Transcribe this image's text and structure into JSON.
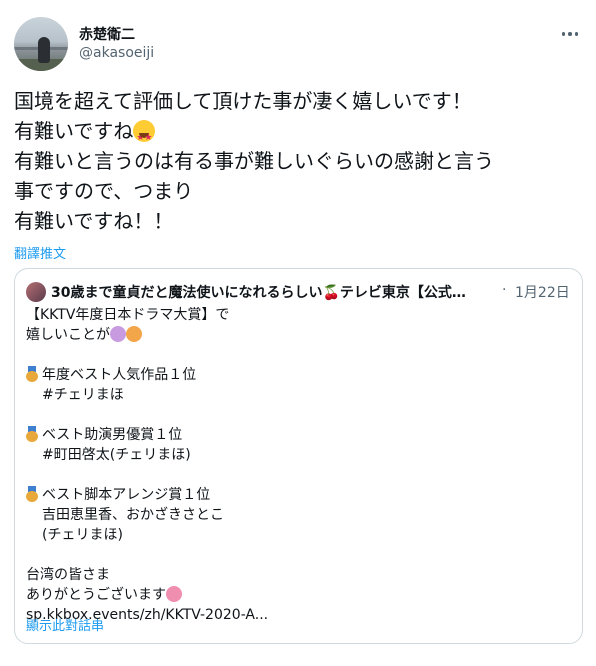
{
  "user": {
    "display_name": "赤楚衛二",
    "username": "@akasoeiji"
  },
  "tweet": {
    "lines": [
      "国境を超えて評価して頂けた事が凄く嬉しいです！",
      "有難いですね",
      "有難いと言うのは有る事が難しいぐらいの感謝と言う",
      "事ですので、つまり",
      "有難いですね！！"
    ],
    "translate_label": "翻譯推文"
  },
  "quote": {
    "name_part1": "30歳まで童貞だと魔法使いになれるらしい",
    "name_part2": "テレビ東京【公式…",
    "date_sep": "·",
    "date": "1月22日",
    "lines": {
      "l1": "【KKTV年度日本ドラマ大賞】で",
      "l2": "嬉しいことが",
      "l3": "年度ベスト人気作品１位",
      "l4": "#チェリまほ",
      "l5": "ベスト助演男優賞１位",
      "l6": "#町田啓太(チェリまほ)",
      "l7": "ベスト脚本アレンジ賞１位",
      "l8": "吉田恵里香、おかざきさとこ",
      "l9": "(チェリまほ)",
      "l10": "台湾の皆さま",
      "l11": "ありがとうございます",
      "l12": "sp.kkbox.events/zh/KKTV-2020-A..."
    },
    "show_thread_label": "顯示此對話串"
  },
  "colors": {
    "text": "#0f1419",
    "secondary": "#536471",
    "link": "#1d9bf0",
    "border": "#cfd9de"
  }
}
